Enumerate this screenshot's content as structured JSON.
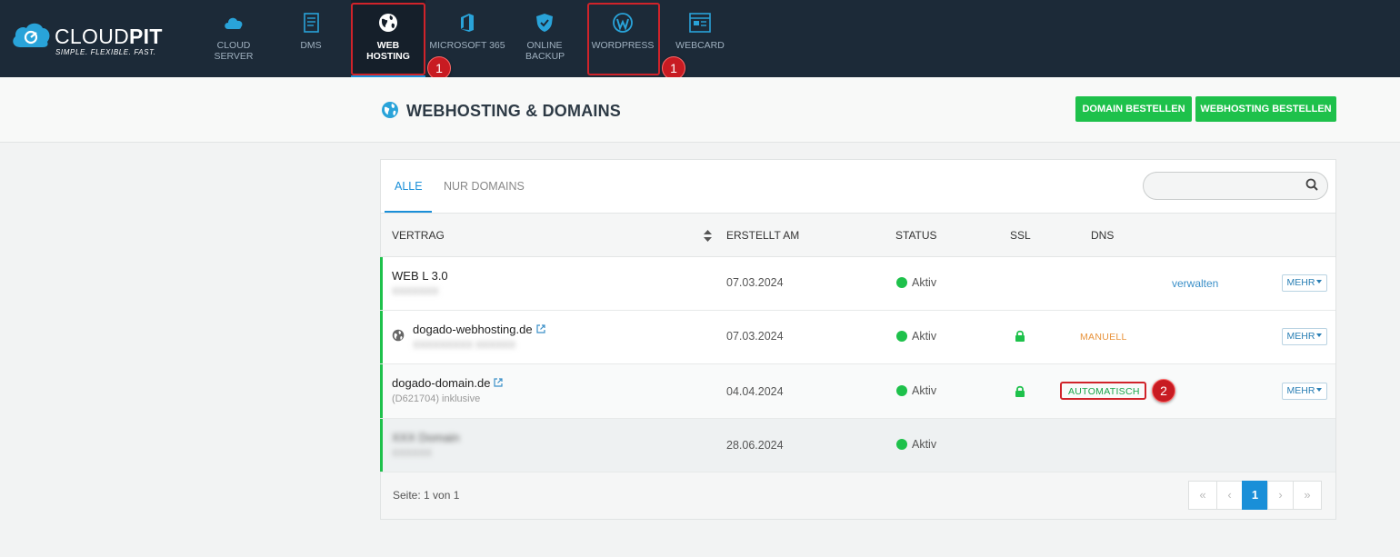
{
  "brand": {
    "name_light": "CLOUD",
    "name_bold": "PIT",
    "tagline": "SIMPLE. FLEXIBLE. FAST."
  },
  "nav": {
    "items": [
      {
        "label": "CLOUD SERVER",
        "icon": "cloud-icon"
      },
      {
        "label": "DMS",
        "icon": "document-icon"
      },
      {
        "label": "WEB HOSTING",
        "icon": "globe-icon",
        "active": true
      },
      {
        "label": "MICROSOFT 365",
        "icon": "office-icon"
      },
      {
        "label": "ONLINE BACKUP",
        "icon": "shield-icon"
      },
      {
        "label": "WORDPRESS",
        "icon": "wordpress-icon"
      },
      {
        "label": "WEBCARD",
        "icon": "webcard-icon"
      }
    ]
  },
  "annotations": {
    "badge_1a": "1",
    "badge_1b": "1",
    "badge_2": "2"
  },
  "header": {
    "title": "WEBHOSTING & DOMAINS",
    "btn_domain": "DOMAIN BESTELLEN",
    "btn_hosting": "WEBHOSTING BESTELLEN"
  },
  "tabs": {
    "all": "ALLE",
    "domains": "NUR DOMAINS"
  },
  "search": {
    "placeholder": ""
  },
  "table": {
    "headers": {
      "contract": "VERTRAG",
      "created": "ERSTELLT AM",
      "status": "STATUS",
      "ssl": "SSL",
      "dns": "DNS"
    },
    "rows": [
      {
        "name": "WEB L 3.0",
        "sub": "XXXXXXX",
        "date": "07.03.2024",
        "status": "Aktiv",
        "action": "verwalten",
        "more": "MEHR"
      },
      {
        "name": "dogado-webhosting.de",
        "sub": "XXXXXXXXX XXXXXX",
        "date": "07.03.2024",
        "status": "Aktiv",
        "dns": "MANUELL",
        "more": "MEHR"
      },
      {
        "name": "dogado-domain.de",
        "sub": "(D621704) inklusive",
        "date": "04.04.2024",
        "status": "Aktiv",
        "dns": "AUTOMATISCH",
        "more": "MEHR"
      },
      {
        "name": "XXX Domain",
        "sub": "XXXXXX",
        "date": "28.06.2024",
        "status": "Aktiv"
      }
    ]
  },
  "pagination": {
    "info": "Seite: 1 von 1",
    "first": "«",
    "prev": "‹",
    "current": "1",
    "next": "›",
    "last": "»"
  },
  "colors": {
    "nav_bg": "#1c2a38",
    "accent_blue": "#1a8fd8",
    "green": "#1ec14b",
    "annotation_red": "#c81b22"
  }
}
